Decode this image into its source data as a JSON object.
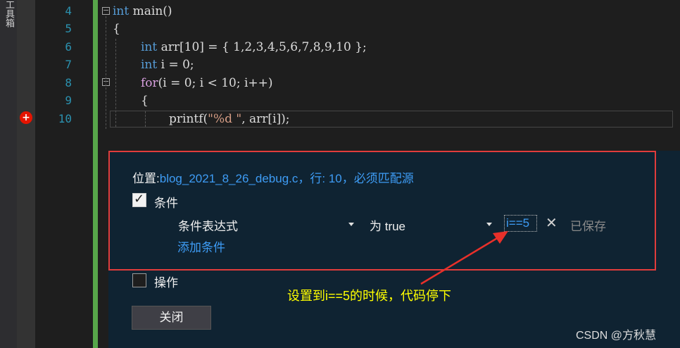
{
  "sidebar": {
    "tool_label": "工具箱"
  },
  "editor": {
    "line_numbers": [
      "4",
      "5",
      "6",
      "7",
      "8",
      "9",
      "10"
    ],
    "code": {
      "l4_kw": "int",
      "l4_rest": " main()",
      "l5": "{",
      "l6_kw": "int",
      "l6_rest": " arr[10] = { 1,2,3,4,5,6,7,8,9,10 };",
      "l7_kw": "int",
      "l7_rest": " i = 0;",
      "l8_kw": "for",
      "l8_rest": "(i = 0; i < 10; i++)",
      "l9": "{",
      "l10_a": "printf(",
      "l10_str": "\"%d \"",
      "l10_b": ", arr[i]);"
    },
    "fold_symbol": "−",
    "breakpoint_symbol": "+"
  },
  "breakpoint_settings": {
    "location_label": "位置:",
    "location_link": "blog_2021_8_26_debug.c，行: 10，必须匹配源",
    "condition_label": "条件",
    "condition_type": "条件表达式",
    "condition_when": "为 true",
    "condition_expression": "i==5",
    "remove_symbol": "✕",
    "saved_status": "已保存",
    "add_condition_link": "添加条件",
    "action_label": "操作",
    "close_button": "关闭"
  },
  "annotation": {
    "text": "设置到i==5的时候，代码停下",
    "color": "#ffff00",
    "arrow_color": "#e8302a"
  },
  "watermark": "CSDN @方秋慧",
  "colors": {
    "accent_border": "#e03c3c",
    "link": "#3e9cf5",
    "keyword": "#569cd6",
    "control_keyword": "#d8a0df",
    "string": "#d69d85",
    "line_number": "#2b91af"
  }
}
